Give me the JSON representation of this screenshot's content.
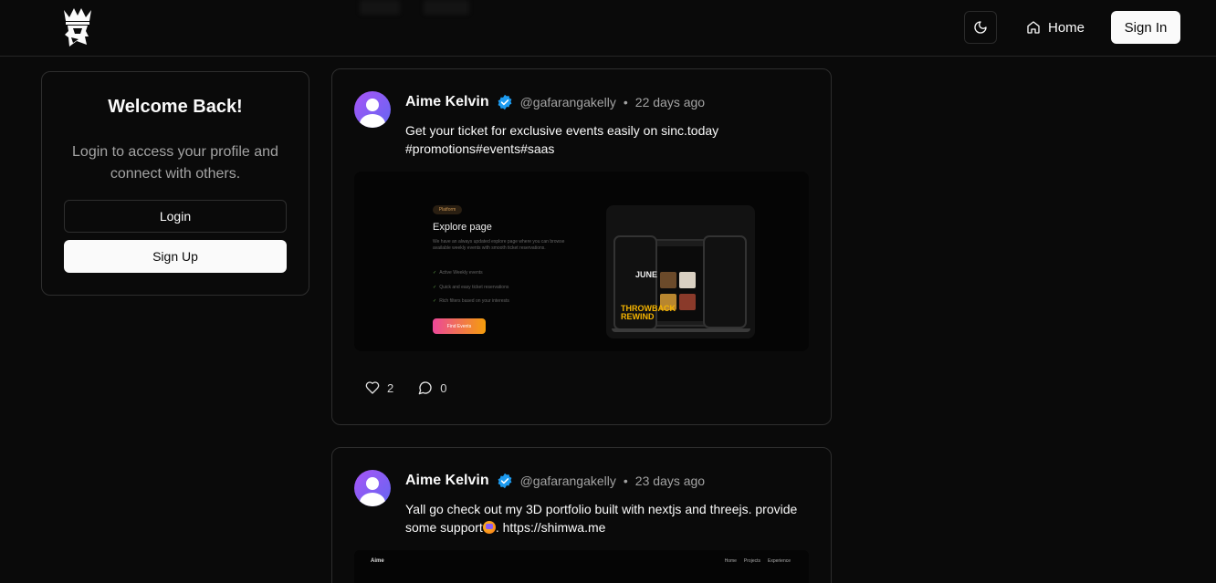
{
  "header": {
    "home_label": "Home",
    "signin_label": "Sign In"
  },
  "welcome": {
    "title": "Welcome Back!",
    "description": "Login to access your profile and connect with others.",
    "login_label": "Login",
    "signup_label": "Sign Up"
  },
  "posts": [
    {
      "author": "Aime Kelvin",
      "handle": "@gafarangakelly",
      "separator": "•",
      "time": "22 days ago",
      "text_line1": "Get your ticket for exclusive events easily on sinc.today",
      "text_line2": "#promotions#events#saas",
      "media": {
        "badge": "Platform",
        "title": "Explore page",
        "description": "We have an always updated explore page where you can browse available weekly events with smooth ticket reservations.",
        "features": [
          "Active Weekly events",
          "Quick and easy ticket reservations",
          "Rich filters based on your interests"
        ],
        "cta": "Find Events",
        "phone_text_1": "JUNE",
        "phone_text_2": "THROWBACK REWIND"
      },
      "likes": "2",
      "comments": "0"
    },
    {
      "author": "Aime Kelvin",
      "handle": "@gafarangakelly",
      "separator": "•",
      "time": "23 days ago",
      "text_line1": "Yall go check out my 3D portfolio built with nextjs and threejs. provide",
      "text_line2a": "some support",
      "text_line2b": ". https://shimwa.me",
      "media": {
        "brand": "Aime",
        "nav": [
          "Home",
          "Projects",
          "Experience"
        ]
      }
    }
  ],
  "colors": {
    "background": "#0a0a0a",
    "border": "#2e2e2e",
    "verified": "#1d9bf0",
    "avatar_gradient": [
      "#a855f7",
      "#6366f1"
    ]
  }
}
